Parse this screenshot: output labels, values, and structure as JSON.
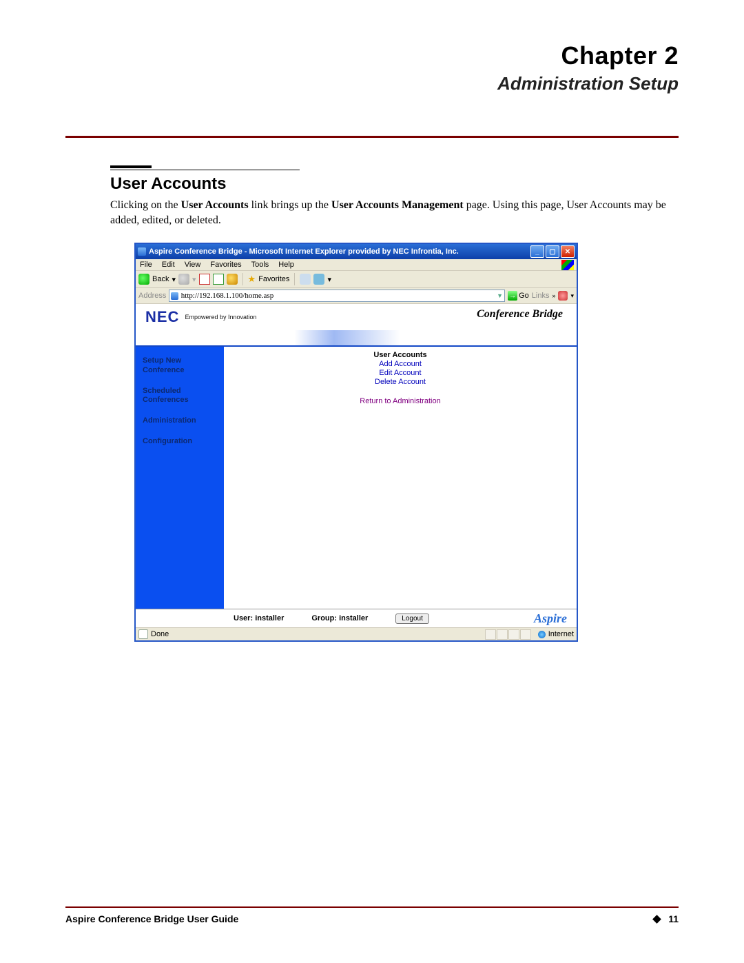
{
  "header": {
    "chapter": "Chapter 2",
    "subtitle": "Administration Setup"
  },
  "section": {
    "heading": "User Accounts",
    "body_prefix": "Clicking on the ",
    "body_bold1": "User Accounts",
    "body_mid": " link brings up the ",
    "body_bold2": "User Accounts Management",
    "body_suffix": " page. Using this page, User Accounts may be added, edited, or deleted."
  },
  "browser": {
    "title": "Aspire Conference Bridge - Microsoft Internet Explorer provided by NEC Infrontia, Inc.",
    "menus": [
      "File",
      "Edit",
      "View",
      "Favorites",
      "Tools",
      "Help"
    ],
    "back_label": "Back",
    "favorites_label": "Favorites",
    "addr_label": "Address",
    "addr_value": "http://192.168.1.100/home.asp",
    "go_label": "Go",
    "links_label": "Links",
    "status_done": "Done",
    "status_zone": "Internet"
  },
  "app": {
    "brand": "NEC",
    "tagline": "Empowered by Innovation",
    "product": "Conference Bridge",
    "sidebar": [
      "Setup New Conference",
      "Scheduled Conferences",
      "Administration",
      "Configuration"
    ],
    "main_heading": "User Accounts",
    "links": [
      "Add Account",
      "Edit Account",
      "Delete Account"
    ],
    "return_link": "Return to Administration",
    "footer_user_label": "User:",
    "footer_user_value": "installer",
    "footer_group_label": "Group:",
    "footer_group_value": "installer",
    "logout": "Logout",
    "aspire": "Aspire"
  },
  "page_footer": {
    "guide": "Aspire Conference Bridge User Guide",
    "page": "11"
  }
}
